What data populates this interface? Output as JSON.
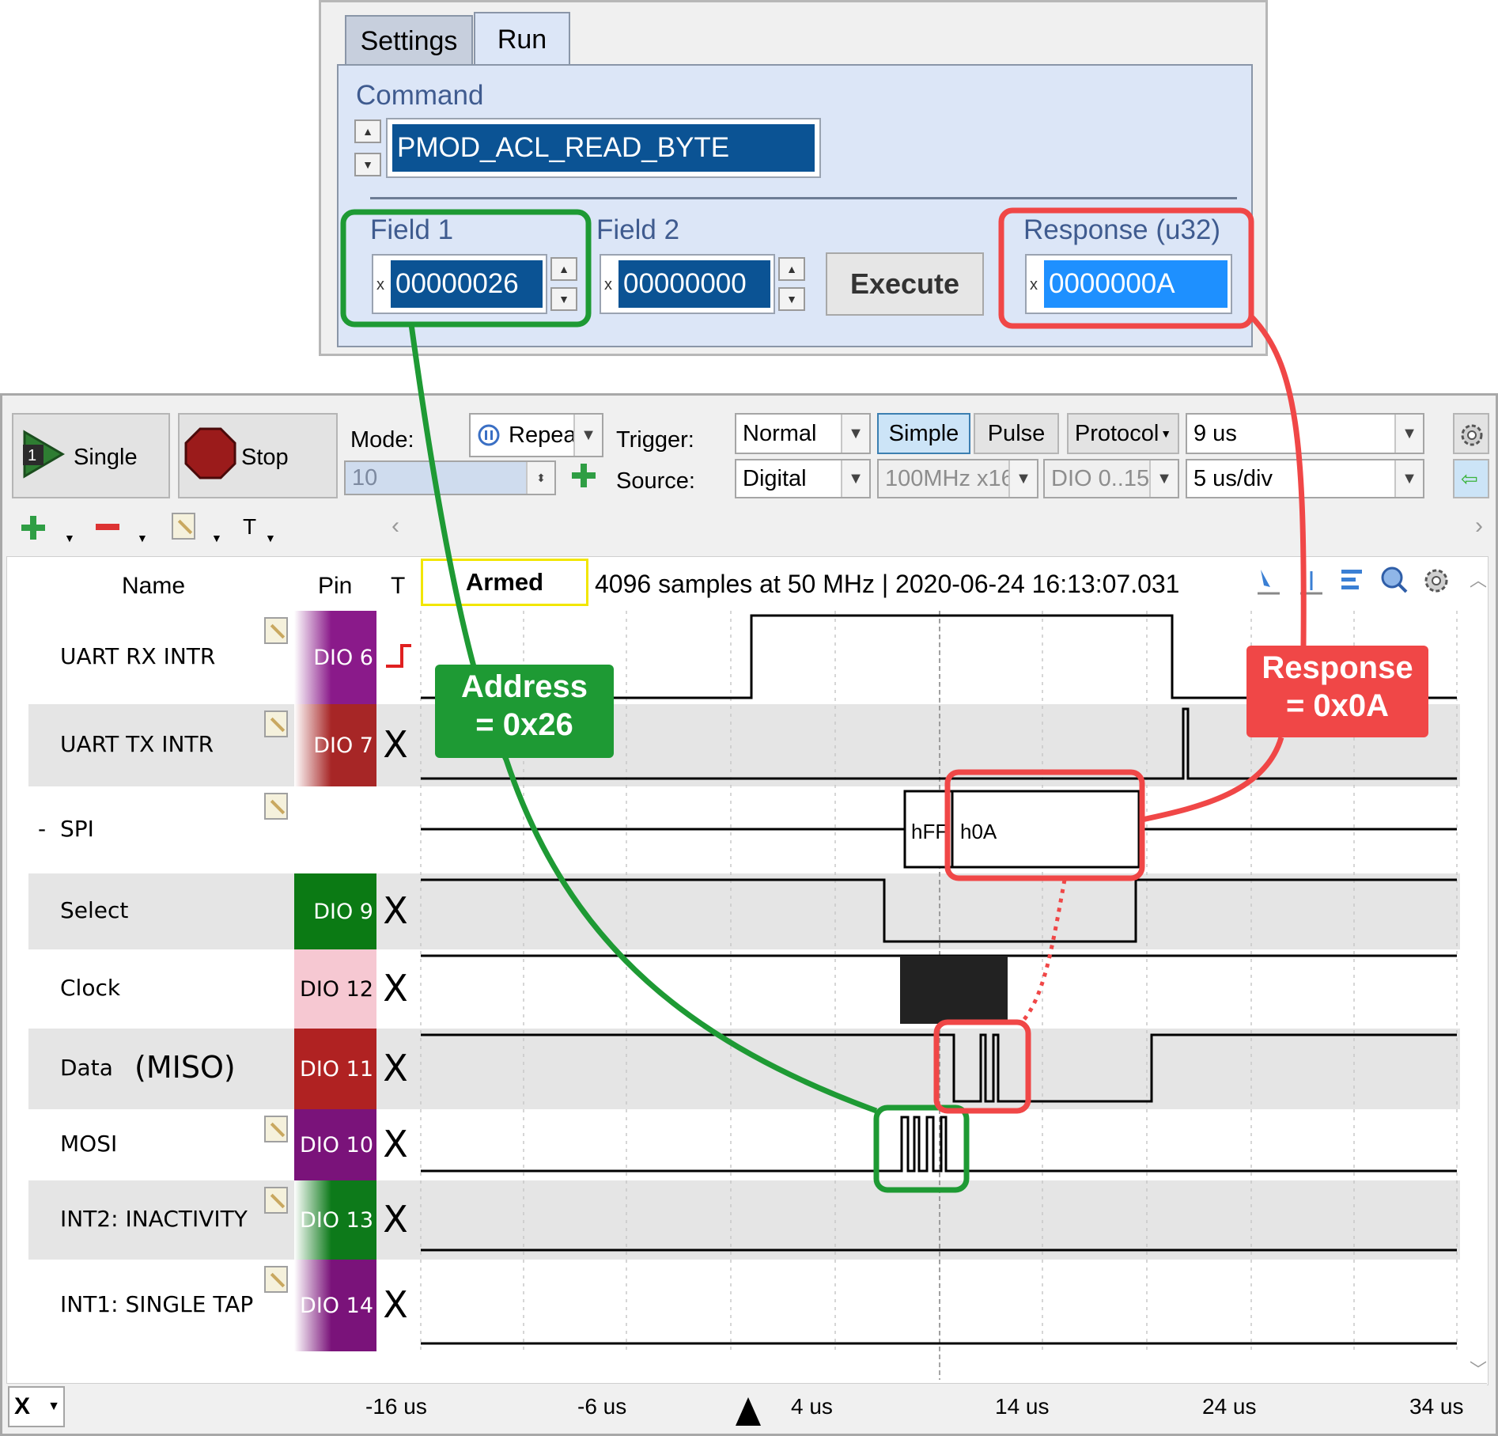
{
  "top_panel": {
    "tabs": [
      "Settings",
      "Run"
    ],
    "command_label": "Command",
    "command_value": "PMOD_ACL_READ_BYTE",
    "field1_label": "Field 1",
    "field1_prefix": "x",
    "field1_value": "00000026",
    "field2_label": "Field 2",
    "field2_prefix": "x",
    "field2_value": "00000000",
    "execute_label": "Execute",
    "response_label": "Response (u32)",
    "response_prefix": "x",
    "response_value": "0000000A"
  },
  "toolbar": {
    "single_label": "Single",
    "stop_label": "Stop",
    "mode_label": "Mode:",
    "mode_value": "Repea",
    "count_value": "10",
    "trigger_label": "Trigger:",
    "trigger_value": "Normal",
    "simple_label": "Simple",
    "pulse_label": "Pulse",
    "protocol_label": "Protocol",
    "position_value": "9 us",
    "source_label": "Source:",
    "source_value": "Digital",
    "rate_value": "100MHz x16",
    "channels_value": "DIO 0..15",
    "timebase_value": "5 us/div"
  },
  "subtoolbar": {
    "t_label": "T"
  },
  "grid": {
    "name_header": "Name",
    "pin_header": "Pin",
    "t_header": "T",
    "status": "Armed",
    "info": "4096 samples at 50 MHz | 2020-06-24 16:13:07.031"
  },
  "signals": [
    {
      "name": "UART RX INTR",
      "pin": "DIO  6",
      "trigger": ""
    },
    {
      "name": "UART TX INTR",
      "pin": "DIO  7",
      "trigger": "X"
    },
    {
      "name": "SPI",
      "prefix": "-",
      "pin": "",
      "trigger": ""
    },
    {
      "name": "Select",
      "pin": "DIO  9",
      "trigger": "X"
    },
    {
      "name": "Clock",
      "pin": "DIO 12",
      "trigger": "X"
    },
    {
      "name": "Data",
      "note": "(MISO)",
      "pin": "DIO 11",
      "trigger": "X"
    },
    {
      "name": "MOSI",
      "pin": "DIO 10",
      "trigger": "X"
    },
    {
      "name": "INT2: INACTIVITY",
      "pin": "DIO 13",
      "trigger": "X"
    },
    {
      "name": "INT1: SINGLE TAP",
      "pin": "DIO 14",
      "trigger": "X"
    }
  ],
  "spi_bytes": [
    "hFF",
    "h0A"
  ],
  "time_axis": {
    "labels": [
      "-16 us",
      "-6 us",
      "4 us",
      "14 us",
      "24 us",
      "34 us"
    ],
    "x_button": "X"
  },
  "annotations": {
    "address_line1": "Address",
    "address_line2": "= 0x26",
    "response_line1": "Response",
    "response_line2": "= 0x0A"
  },
  "colors": {
    "green_callout": "#1e9a34",
    "red_callout": "#f04747",
    "selected_field": "#0b5394",
    "response_field": "#1e90ff"
  }
}
